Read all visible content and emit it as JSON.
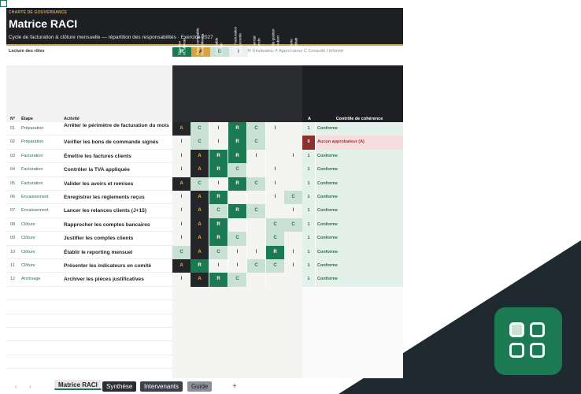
{
  "header": {
    "kicker": "CHARTE DE GOUVERNANCE",
    "title": "Matrice RACI",
    "subtitle": "Cycle de facturation & clôture mensuelle — répartition des responsabilités · Exercice 2027"
  },
  "legend": {
    "title": "Lecture des rôles",
    "chips": [
      "R",
      "A",
      "C",
      "I"
    ],
    "description": "R Réalisateur  A Approbateur  C Consulté  I Informé"
  },
  "columns": {
    "num": "N°",
    "step": "Étape",
    "activity": "Activité",
    "a_count": "A",
    "check": "Contrôle de cohérence"
  },
  "roles": [
    {
      "line1": "Direction",
      "line2": "M. Moreau"
    },
    {
      "line1": "Resp. comptable",
      "line2": "Mme Olivetta"
    },
    {
      "line1": "Comptable",
      "line2": "M. Tran"
    },
    {
      "line1": "ADV / Facturation",
      "line2": "Mme Leconte"
    },
    {
      "line1": "Commercial",
      "line2": "M. Bianchi"
    },
    {
      "line1": "Contrôle gestion",
      "line2": "Mme Aubert"
    },
    {
      "line1": "Trésorerie",
      "line2": "M. Kebbab"
    }
  ],
  "rows": [
    {
      "num": "01",
      "step": "Préparation",
      "activity": "Arrêter le périmètre de facturation du mois",
      "roles": [
        "A",
        "C",
        "I",
        "R",
        "C",
        "I",
        ""
      ],
      "a_count": "1",
      "check": "Conforme",
      "status": "ok"
    },
    {
      "num": "02",
      "step": "Préparation",
      "activity": "Vérifier les bons de commande signés",
      "roles": [
        "I",
        "C",
        "I",
        "R",
        "C",
        "",
        ""
      ],
      "a_count": "0",
      "check": "Aucun approbateur (A)",
      "status": "bad"
    },
    {
      "num": "03",
      "step": "Facturation",
      "activity": "Émettre les factures clients",
      "roles": [
        "I",
        "A",
        "R",
        "R",
        "I",
        "",
        "I"
      ],
      "a_count": "1",
      "check": "Conforme",
      "status": "ok"
    },
    {
      "num": "04",
      "step": "Facturation",
      "activity": "Contrôler la TVA appliquée",
      "roles": [
        "I",
        "A",
        "R",
        "C",
        "",
        "I",
        ""
      ],
      "a_count": "1",
      "check": "Conforme",
      "status": "ok"
    },
    {
      "num": "05",
      "step": "Facturation",
      "activity": "Valider les avoirs et remises",
      "roles": [
        "A",
        "C",
        "I",
        "R",
        "C",
        "I",
        ""
      ],
      "a_count": "1",
      "check": "Conforme",
      "status": "ok"
    },
    {
      "num": "06",
      "step": "Encaissement",
      "activity": "Enregistrer les règlements reçus",
      "roles": [
        "I",
        "A",
        "R",
        "",
        "",
        "I",
        "C"
      ],
      "a_count": "1",
      "check": "Conforme",
      "status": "ok"
    },
    {
      "num": "07",
      "step": "Encaissement",
      "activity": "Lancer les relances clients (J+15)",
      "roles": [
        "I",
        "A",
        "C",
        "R",
        "C",
        "",
        "I"
      ],
      "a_count": "1",
      "check": "Conforme",
      "status": "ok"
    },
    {
      "num": "08",
      "step": "Clôture",
      "activity": "Rapprocher les comptes bancaires",
      "roles": [
        "I",
        "A",
        "R",
        "",
        "",
        "C",
        "C"
      ],
      "a_count": "1",
      "check": "Conforme",
      "status": "ok"
    },
    {
      "num": "09",
      "step": "Clôture",
      "activity": "Justifier les comptes clients",
      "roles": [
        "I",
        "A",
        "R",
        "C",
        "",
        "C",
        ""
      ],
      "a_count": "1",
      "check": "Conforme",
      "status": "ok"
    },
    {
      "num": "10",
      "step": "Clôture",
      "activity": "Établir le reporting mensuel",
      "roles": [
        "C",
        "A",
        "C",
        "I",
        "I",
        "R",
        "I"
      ],
      "a_count": "1",
      "check": "Conforme",
      "status": "ok"
    },
    {
      "num": "11",
      "step": "Clôture",
      "activity": "Présenter les indicateurs en comité",
      "roles": [
        "A",
        "R",
        "I",
        "I",
        "C",
        "C",
        "I"
      ],
      "a_count": "1",
      "check": "Conforme",
      "status": "ok"
    },
    {
      "num": "12",
      "step": "Archivage",
      "activity": "Archiver les pièces justificatives",
      "roles": [
        "I",
        "A",
        "R",
        "C",
        "",
        "",
        ""
      ],
      "a_count": "1",
      "check": "Conforme",
      "status": "ok"
    }
  ],
  "tabs": [
    {
      "label": "Matrice RACI",
      "active": true
    },
    {
      "label": "Synthèse",
      "active": false
    },
    {
      "label": "Intervenants",
      "active": false
    },
    {
      "label": "Guide",
      "active": false
    }
  ],
  "add_tab": "+",
  "nav": {
    "prev": "‹",
    "next": "›"
  },
  "colors": {
    "brand_green": "#1c7a52",
    "dark": "#1e1f22",
    "gold": "#c9a25a",
    "consult": "#c8e1d4",
    "error": "#8e2f2f"
  }
}
